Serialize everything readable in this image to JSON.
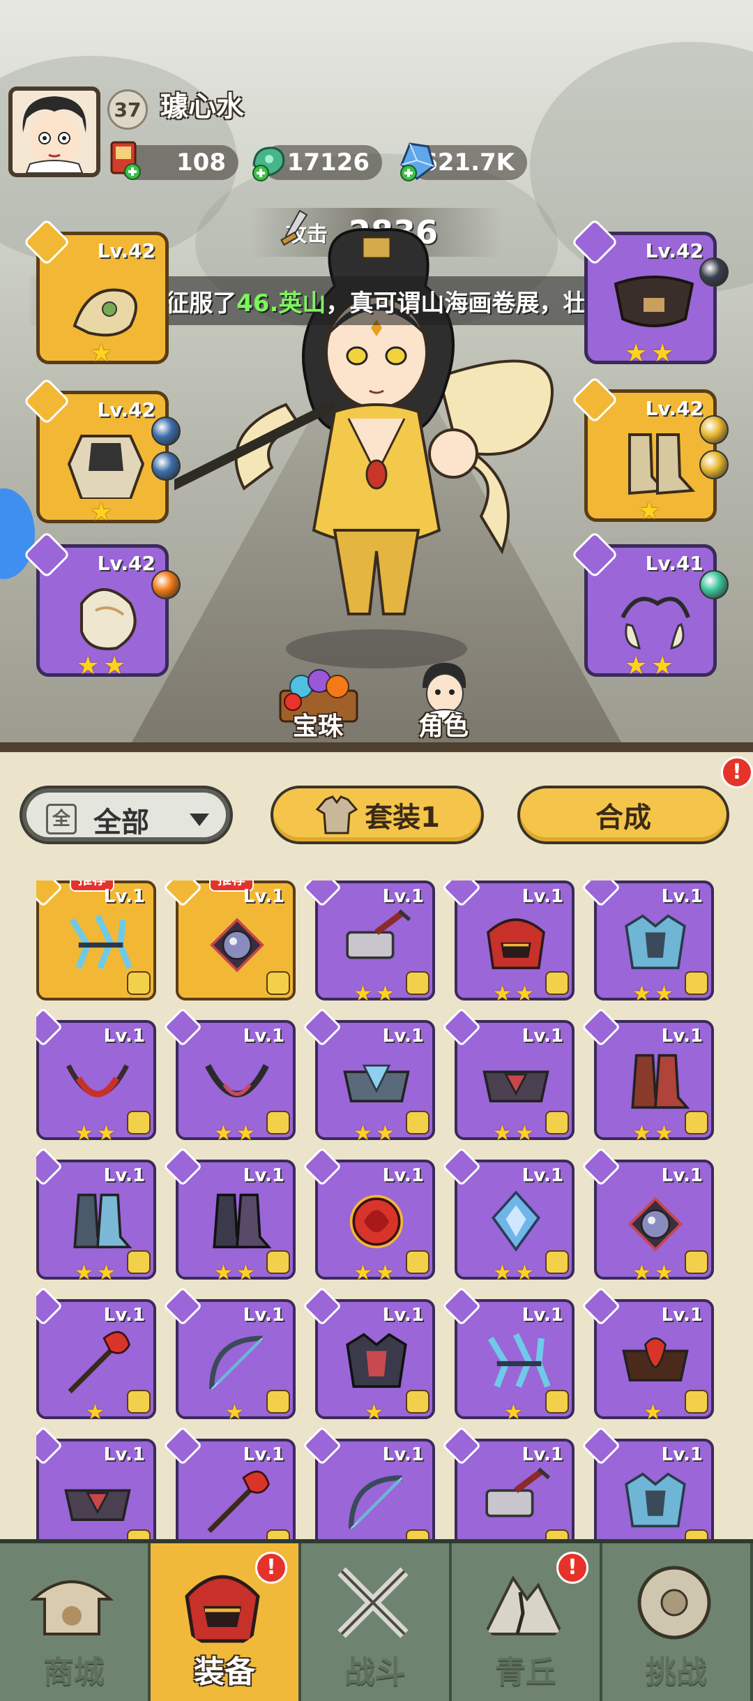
{
  "player": {
    "level": "37",
    "name": "璩心水"
  },
  "resources": [
    {
      "icon": "scroll-token-icon",
      "value": "108"
    },
    {
      "icon": "jade-dragon-icon",
      "value": "17126"
    },
    {
      "icon": "blue-crystal-icon",
      "value": "621.7K"
    }
  ],
  "attack": {
    "label": "攻击",
    "value": "2836"
  },
  "banner": {
    "prefix": "山，成功征服了 ",
    "highlight": "46.英山",
    "suffix": "，真可谓山海画卷展，壮志凌云!"
  },
  "equipped": [
    {
      "lv": "Lv.42",
      "stars": 1,
      "rarity": "gold",
      "orbs": []
    },
    {
      "lv": "Lv.42",
      "stars": 2,
      "rarity": "purple",
      "orbs": [
        "#3a3f4e"
      ]
    },
    {
      "lv": "Lv.42",
      "stars": 1,
      "rarity": "gold",
      "orbs": [
        "#3e6ea8",
        "#3e6ea8"
      ]
    },
    {
      "lv": "Lv.42",
      "stars": 1,
      "rarity": "gold",
      "orbs": [
        "#e8b830",
        "#e8b830"
      ]
    },
    {
      "lv": "Lv.42",
      "stars": 2,
      "rarity": "purple",
      "orbs": [
        "#f27a18"
      ]
    },
    {
      "lv": "Lv.41",
      "stars": 2,
      "rarity": "purple",
      "orbs": [
        "#3ec49a"
      ]
    }
  ],
  "actions": {
    "pearl": "宝珠",
    "role": "角色"
  },
  "filter": {
    "box": "全",
    "label": "全部"
  },
  "buttons": {
    "set": "套装1",
    "merge": "合成",
    "badge": "!"
  },
  "recommend_label": "推荐",
  "inventory": [
    {
      "lv": "Lv.1",
      "stars": 0,
      "gold": true,
      "rec": true,
      "art": "cyan-claw"
    },
    {
      "lv": "Lv.1",
      "stars": 0,
      "gold": true,
      "rec": true,
      "art": "dark-orb"
    },
    {
      "lv": "Lv.1",
      "stars": 2,
      "gold": false,
      "rec": false,
      "art": "hammer"
    },
    {
      "lv": "Lv.1",
      "stars": 2,
      "gold": false,
      "rec": false,
      "art": "red-helmet"
    },
    {
      "lv": "Lv.1",
      "stars": 2,
      "gold": false,
      "rec": false,
      "art": "ice-armor"
    },
    {
      "lv": "Lv.1",
      "stars": 2,
      "gold": false,
      "rec": false,
      "art": "red-necklace"
    },
    {
      "lv": "Lv.1",
      "stars": 2,
      "gold": false,
      "rec": false,
      "art": "dark-necklace"
    },
    {
      "lv": "Lv.1",
      "stars": 2,
      "gold": false,
      "rec": false,
      "art": "ice-belt"
    },
    {
      "lv": "Lv.1",
      "stars": 2,
      "gold": false,
      "rec": false,
      "art": "dark-belt"
    },
    {
      "lv": "Lv.1",
      "stars": 2,
      "gold": false,
      "rec": false,
      "art": "red-boots"
    },
    {
      "lv": "Lv.1",
      "stars": 2,
      "gold": false,
      "rec": false,
      "art": "ice-boots"
    },
    {
      "lv": "Lv.1",
      "stars": 2,
      "gold": false,
      "rec": false,
      "art": "dark-boots"
    },
    {
      "lv": "Lv.1",
      "stars": 2,
      "gold": false,
      "rec": false,
      "art": "red-orb"
    },
    {
      "lv": "Lv.1",
      "stars": 2,
      "gold": false,
      "rec": false,
      "art": "ice-charm"
    },
    {
      "lv": "Lv.1",
      "stars": 2,
      "gold": false,
      "rec": false,
      "art": "dark-orb"
    },
    {
      "lv": "Lv.1",
      "stars": 1,
      "gold": false,
      "rec": false,
      "art": "red-staff"
    },
    {
      "lv": "Lv.1",
      "stars": 1,
      "gold": false,
      "rec": false,
      "art": "ice-bow"
    },
    {
      "lv": "Lv.1",
      "stars": 1,
      "gold": false,
      "rec": false,
      "art": "dark-armor"
    },
    {
      "lv": "Lv.1",
      "stars": 1,
      "gold": false,
      "rec": false,
      "art": "cyan-claw"
    },
    {
      "lv": "Lv.1",
      "stars": 1,
      "gold": false,
      "rec": false,
      "art": "red-belt"
    },
    {
      "lv": "Lv.1",
      "stars": 0,
      "gold": false,
      "rec": false,
      "art": "dark-belt"
    },
    {
      "lv": "Lv.1",
      "stars": 0,
      "gold": false,
      "rec": false,
      "art": "red-staff"
    },
    {
      "lv": "Lv.1",
      "stars": 0,
      "gold": false,
      "rec": false,
      "art": "ice-bow"
    },
    {
      "lv": "Lv.1",
      "stars": 0,
      "gold": false,
      "rec": false,
      "art": "hammer"
    },
    {
      "lv": "Lv.1",
      "stars": 0,
      "gold": false,
      "rec": false,
      "art": "ice-armor"
    }
  ],
  "nav": [
    {
      "label": "商城",
      "icon": "shop-pavilion-icon",
      "active": false,
      "badge": false
    },
    {
      "label": "装备",
      "icon": "red-helmet-icon",
      "active": true,
      "badge": true
    },
    {
      "label": "战斗",
      "icon": "crossed-swords-icon",
      "active": false,
      "badge": false
    },
    {
      "label": "青丘",
      "icon": "mountain-icon",
      "active": false,
      "badge": true
    },
    {
      "label": "挑战",
      "icon": "stone-disc-icon",
      "active": false,
      "badge": false
    }
  ],
  "colors": {
    "gold": "#f2b835",
    "purple": "#9a66d8",
    "nav": "#6f8470",
    "badge": "#e5332a"
  }
}
